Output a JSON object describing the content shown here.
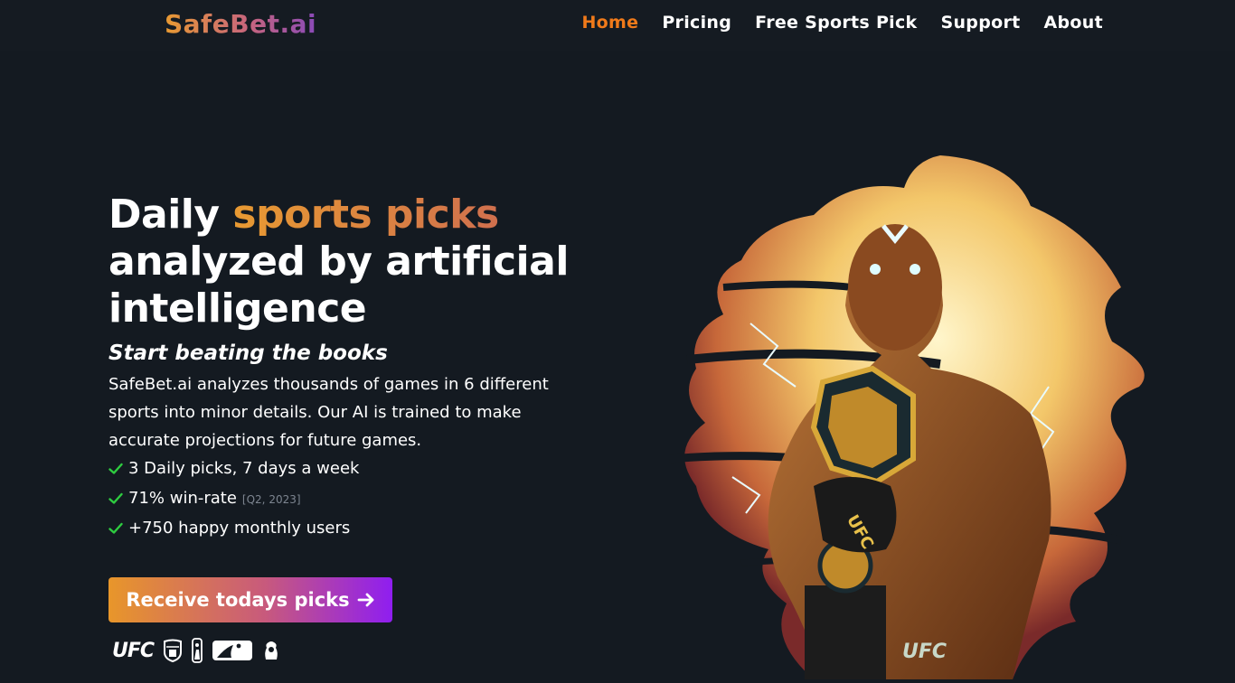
{
  "header": {
    "logo": "SafeBet.ai",
    "nav": [
      {
        "label": "Home",
        "active": true
      },
      {
        "label": "Pricing",
        "active": false
      },
      {
        "label": "Free Sports Pick",
        "active": false
      },
      {
        "label": "Support",
        "active": false
      },
      {
        "label": "About",
        "active": false
      }
    ]
  },
  "hero": {
    "headline_part1": "Daily ",
    "headline_accent": "sports picks",
    "headline_part2": "analyzed by artificial intelligence",
    "subheading": "Start beating the books",
    "description": "SafeBet.ai analyzes thousands of games in 6 different sports into minor details. Our AI is trained to make accurate projections for future games.",
    "features": [
      {
        "text": "3 Daily picks, 7 days a week",
        "note": ""
      },
      {
        "text": "71% win-rate",
        "note": "[Q2, 2023]"
      },
      {
        "text": "+750 happy monthly users",
        "note": ""
      }
    ],
    "cta_label": "Receive todays picks",
    "leagues": {
      "ufc": "UFC",
      "art_logo": "UFC"
    }
  },
  "colors": {
    "background": "#141a21",
    "nav_active": "#f07a1a",
    "check": "#2ecc40",
    "gradient_start": "#e8962a",
    "gradient_end": "#8f1ef0"
  },
  "icons": [
    "check-icon",
    "arrow-right-icon",
    "nfl-shield-icon",
    "nba-icon",
    "mlb-icon",
    "premier-league-icon"
  ]
}
